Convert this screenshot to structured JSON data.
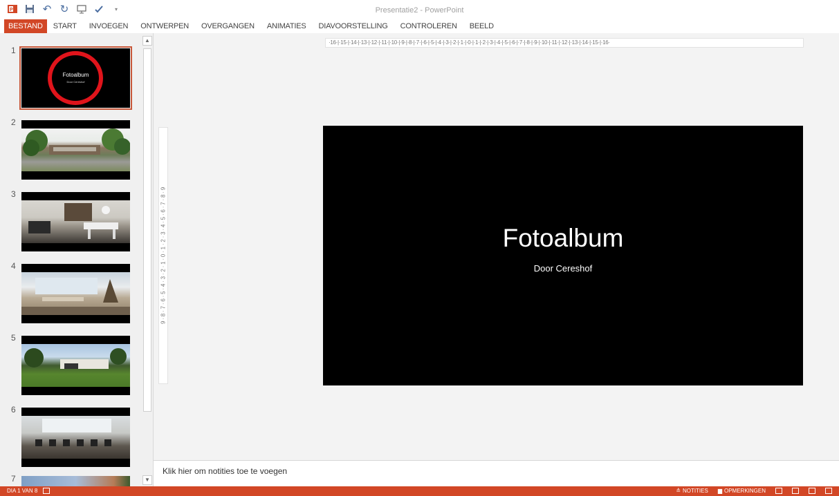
{
  "window": {
    "title": "Presentatie2 - PowerPoint"
  },
  "quick_access": {
    "icons": [
      "powerpoint-logo-icon",
      "save-icon",
      "undo-icon",
      "redo-icon",
      "presentation-icon",
      "spelling-icon",
      "customize-arrow-icon"
    ],
    "undo_glyph": "↶",
    "redo_glyph": "↻",
    "customize_glyph": "▾"
  },
  "ribbon": {
    "tabs": [
      "BESTAND",
      "START",
      "INVOEGEN",
      "ONTWERPEN",
      "OVERGANGEN",
      "ANIMATIES",
      "DIAVOORSTELLING",
      "CONTROLEREN",
      "BEELD"
    ]
  },
  "thumbnails": [
    {
      "number": "1",
      "title": "Fotoalbum",
      "subtitle": "Door Cereshof"
    },
    {
      "number": "2"
    },
    {
      "number": "3"
    },
    {
      "number": "4"
    },
    {
      "number": "5"
    },
    {
      "number": "6"
    },
    {
      "number": "7"
    }
  ],
  "scrollbar": {
    "up_glyph": "▲",
    "down_glyph": "▼"
  },
  "rulers": {
    "horizontal": "·16·|·15·|·14·|·13·|·12·|·11·|·10·|·9·|·8·|·7·|·6·|·5·|·4·|·3·|·2·|·1·|·0·|·1·|·2·|·3·|·4·|·5·|·6·|·7·|·8·|·9·|·10·|·11·|·12·|·13·|·14·|·15·|·16·",
    "vertical": "9 · 8 · 7 · 6 · 5 · 4 · 3 · 2 · 1 · 0 · 1 · 2 · 3 · 4 · 5 · 6 · 7 · 8 · 9"
  },
  "slide": {
    "title": "Fotoalbum",
    "subtitle": "Door Cereshof"
  },
  "notes": {
    "placeholder": "Klik hier om notities toe te voegen"
  },
  "status_bar": {
    "slide_info": "DIA 1 VAN 8",
    "notes_label": "NOTITIES",
    "comments_label": "OPMERKINGEN",
    "notes_glyph": "≙",
    "comments_glyph": "▆"
  },
  "colors": {
    "accent": "#d24726",
    "highlight_circle": "#e0141b"
  }
}
